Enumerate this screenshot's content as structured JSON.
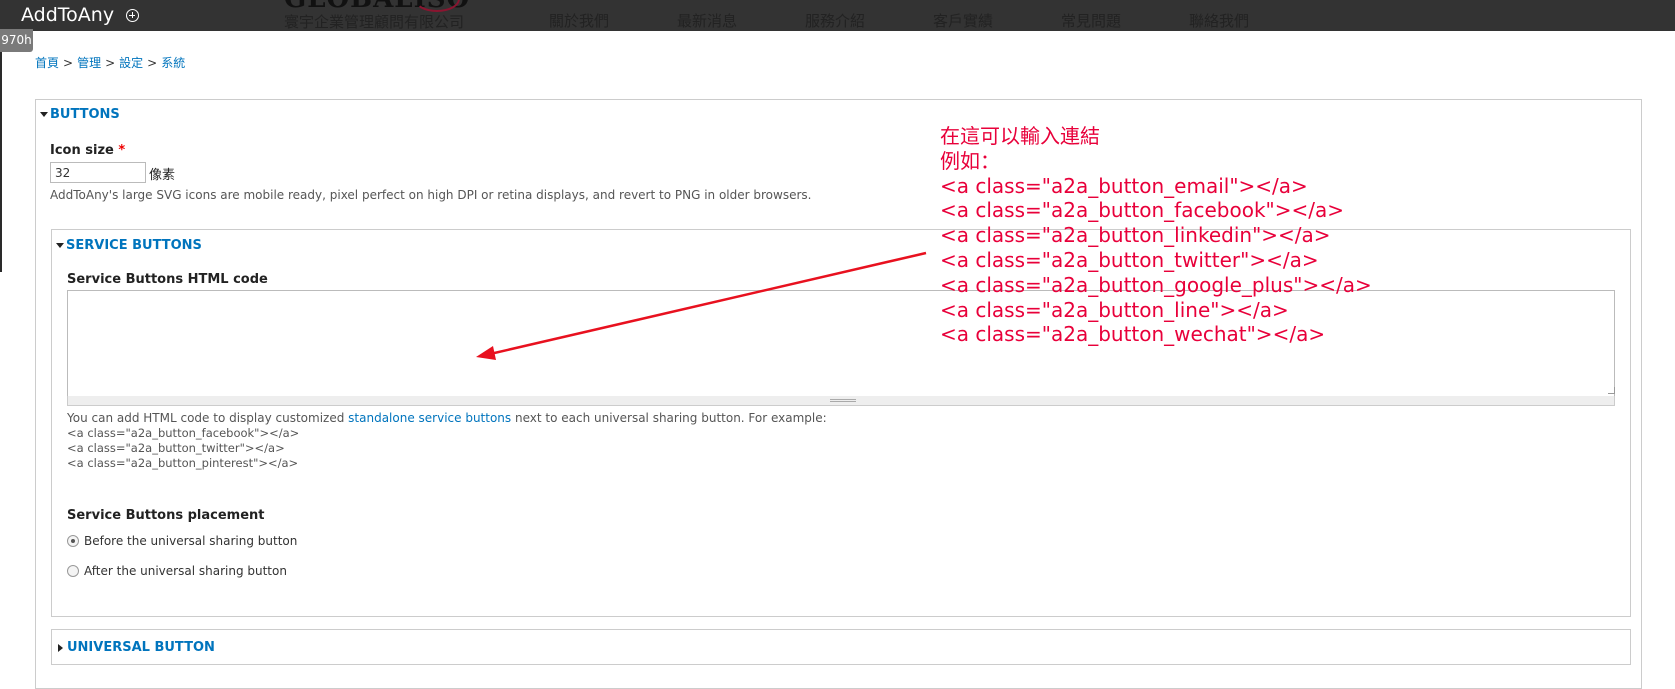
{
  "topbar": {
    "app_title": "AddToAny",
    "logo_text": "GLOBALISO",
    "logo_subtitle": "寰宇企業管理顧問有限公司",
    "nav": [
      "關於我們",
      "最新消息",
      "服務介紹",
      "客戶實績",
      "常見問題",
      "聯絡我們"
    ]
  },
  "badge": "970h",
  "breadcrumb": [
    "首頁",
    "管理",
    "設定",
    "系統"
  ],
  "breadcrumb_sep": ">",
  "buttons": {
    "legend": "BUTTONS",
    "icon_size_label": "Icon size",
    "required_mark": "*",
    "icon_size_value": "32",
    "icon_size_unit": "像素",
    "icon_size_desc": "AddToAny's large SVG icons are mobile ready, pixel perfect on high DPI or retina displays, and revert to PNG in older browsers."
  },
  "service": {
    "legend": "SERVICE BUTTONS",
    "html_label": "Service Buttons HTML code",
    "html_value": "",
    "help_before": "You can add HTML code to display customized ",
    "help_link": "standalone service buttons",
    "help_after": " next to each universal sharing button. For example:",
    "examples": [
      "<a class=\"a2a_button_facebook\"></a>",
      "<a class=\"a2a_button_twitter\"></a>",
      "<a class=\"a2a_button_pinterest\"></a>"
    ],
    "placement_label": "Service Buttons placement",
    "placement_options": [
      {
        "label": "Before the universal sharing button",
        "checked": true
      },
      {
        "label": "After the universal sharing button",
        "checked": false
      }
    ]
  },
  "universal": {
    "legend": "UNIVERSAL BUTTON"
  },
  "annotation": {
    "color": "#e8003a",
    "lines": [
      "在這可以輸入連結",
      "例如：",
      "<a class=\"a2a_button_email\"></a>",
      "<a class=\"a2a_button_facebook\"></a>",
      "<a class=\"a2a_button_linkedin\"></a>",
      "<a class=\"a2a_button_twitter\"></a>",
      "<a class=\"a2a_button_google_plus\"></a>",
      "<a class=\"a2a_button_line\"></a>",
      "<a class=\"a2a_button_wechat\"></a>"
    ]
  },
  "colors": {
    "topbar": "#333333",
    "link": "#0074bd",
    "annotation": "#e8003a"
  }
}
